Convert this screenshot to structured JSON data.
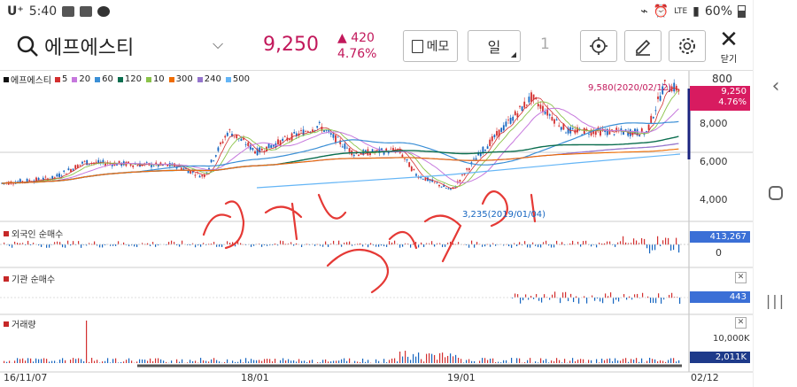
{
  "status": {
    "carrier": "U⁺",
    "time": "5:40",
    "network": "LTE",
    "battery": "60%"
  },
  "stock": {
    "name": "에프에스티",
    "price": "9,250",
    "change": "420",
    "change_pct": "4.76%"
  },
  "toolbar": {
    "memo_label": "메모",
    "period_label": "일",
    "period_num": "1",
    "close_label": "닫기"
  },
  "legend": {
    "name": "에프에스티",
    "ma": [
      {
        "label": "5",
        "color": "#d32f2f"
      },
      {
        "label": "20",
        "color": "#c678dd"
      },
      {
        "label": "60",
        "color": "#3b8fd6"
      },
      {
        "label": "120",
        "color": "#0b6e4f"
      },
      {
        "label": "10",
        "color": "#8bc34a"
      },
      {
        "label": "300",
        "color": "#ef6c00"
      },
      {
        "label": "240",
        "color": "#9575cd"
      },
      {
        "label": "500",
        "color": "#64b5f6"
      }
    ]
  },
  "price_axis": {
    "top": "800",
    "ticks": [
      "8,000",
      "6,000",
      "4,000"
    ],
    "current": "9,250",
    "current_pct": "4.76%"
  },
  "annotations": {
    "high": "9,580(2020/02/12)",
    "low": "3,235(2019/01/04)"
  },
  "panels": {
    "foreign": {
      "title": "외국인 순매수",
      "value": "413,267",
      "zero": "0"
    },
    "inst": {
      "title": "기관 순매수",
      "value": "443"
    },
    "volume": {
      "title": "거래량",
      "value": "2,011K",
      "tick": "10,000K"
    }
  },
  "x_axis": [
    "16/11/07",
    "18/01",
    "19/01",
    "02/12"
  ],
  "colors": {
    "up": "#d32f2f",
    "down": "#1565c0",
    "accent": "#c2185b"
  }
}
